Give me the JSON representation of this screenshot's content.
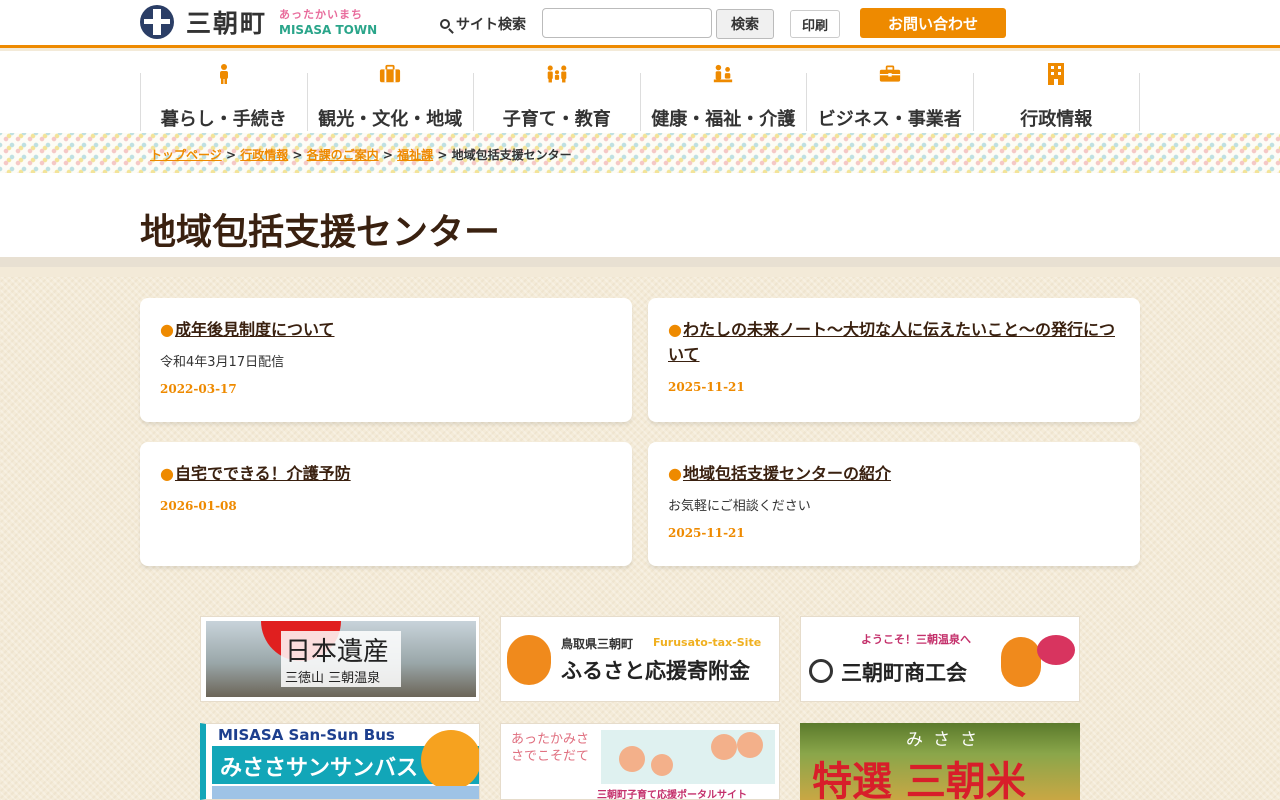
{
  "header": {
    "logo_text": "三朝町",
    "logo_sub1": "あったかいまち",
    "logo_sub2": "MISASA TOWN",
    "search_label": "サイト検索",
    "search_placeholder": "",
    "search_button": "検索",
    "print_button": "印刷",
    "contact_button": "お問い合わせ",
    "accent_color": "#ee8a00"
  },
  "nav": {
    "items": [
      {
        "label": "暮らし・手続き",
        "icon": "person-icon"
      },
      {
        "label": "観光・文化・地域",
        "icon": "suitcase-icon"
      },
      {
        "label": "子育て・教育",
        "icon": "family-icon"
      },
      {
        "label": "健康・福祉・介護",
        "icon": "care-icon"
      },
      {
        "label": "ビジネス・事業者",
        "icon": "briefcase-icon"
      },
      {
        "label": "行政情報",
        "icon": "building-icon"
      }
    ]
  },
  "breadcrumb": {
    "items": [
      "トップページ",
      "行政情報",
      "各課のご案内",
      "福祉課"
    ],
    "separator": ">",
    "current": "地域包括支援センター"
  },
  "page": {
    "title": "地域包括支援センター"
  },
  "cards": [
    {
      "title": "成年後見制度について",
      "desc": "令和4年3月17日配信",
      "date": "2022-03-17"
    },
    {
      "title": "わたしの未来ノート～大切な人に伝えたいこと～の発行について",
      "desc": "",
      "date": "2025-11-21"
    },
    {
      "title": "自宅でできる！介護予防",
      "desc": "",
      "date": "2026-01-08"
    },
    {
      "title": "地域包括支援センターの紹介",
      "desc": "お気軽にご相談ください",
      "date": "2025-11-21"
    }
  ],
  "banners": [
    {
      "line1": "日本遺産",
      "line2": "三徳山 三朝温泉"
    },
    {
      "line1": "鳥取県三朝町",
      "line2": "ふるさと応援寄附金",
      "line3": "Furusato-tax-Site"
    },
    {
      "line1": "ようこそ！三朝温泉へ",
      "line2": "三朝町商工会"
    },
    {
      "line1": "MISASA San-Sun Bus",
      "line2": "みささサンサンバス"
    },
    {
      "line1": "あったかみささでこそだて",
      "line2": "三朝町子育て応援ポータルサイト"
    },
    {
      "line1": "みささ",
      "line2": "特選 三朝米"
    }
  ]
}
